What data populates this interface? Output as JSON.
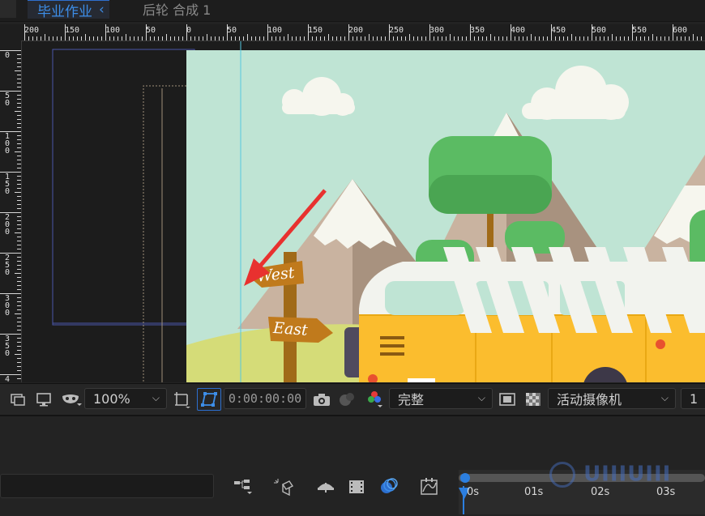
{
  "tabs": {
    "active_label": "毕业作业",
    "breadcrumb_label": "后轮 合成 1"
  },
  "ruler": {
    "h_labels": [
      "200",
      "150",
      "100",
      "50",
      "0",
      "50",
      "100",
      "150",
      "200",
      "250",
      "300",
      "350",
      "400",
      "450",
      "500",
      "550",
      "600"
    ],
    "v_labels": [
      "0",
      "50",
      "100",
      "150",
      "200",
      "250",
      "300",
      "350",
      "4"
    ]
  },
  "scene": {
    "sign_west": "West",
    "sign_east": "East",
    "colors": {
      "sky": "#bfe4d4",
      "mountain_light": "#c9b3a0",
      "mountain_dark": "#a8927f",
      "snow": "#f6f6ee",
      "tree": "#5bbb63",
      "trunk": "#a06a18",
      "ground": "#d5dc78",
      "van_yellow": "#fbbd2e",
      "van_white": "#f2f3ee",
      "window": "#bfe4d4",
      "sign": "#c07a1c",
      "arrow": "#e8312f"
    }
  },
  "toolbar": {
    "zoom": "100%",
    "timecode": "0:00:00:00",
    "resolution": "完整",
    "camera": "活动摄像机",
    "views": "1"
  },
  "timeline": {
    "labels": [
      "0s",
      "01s",
      "02s",
      "03s"
    ]
  },
  "watermark": "UIIIUIII"
}
